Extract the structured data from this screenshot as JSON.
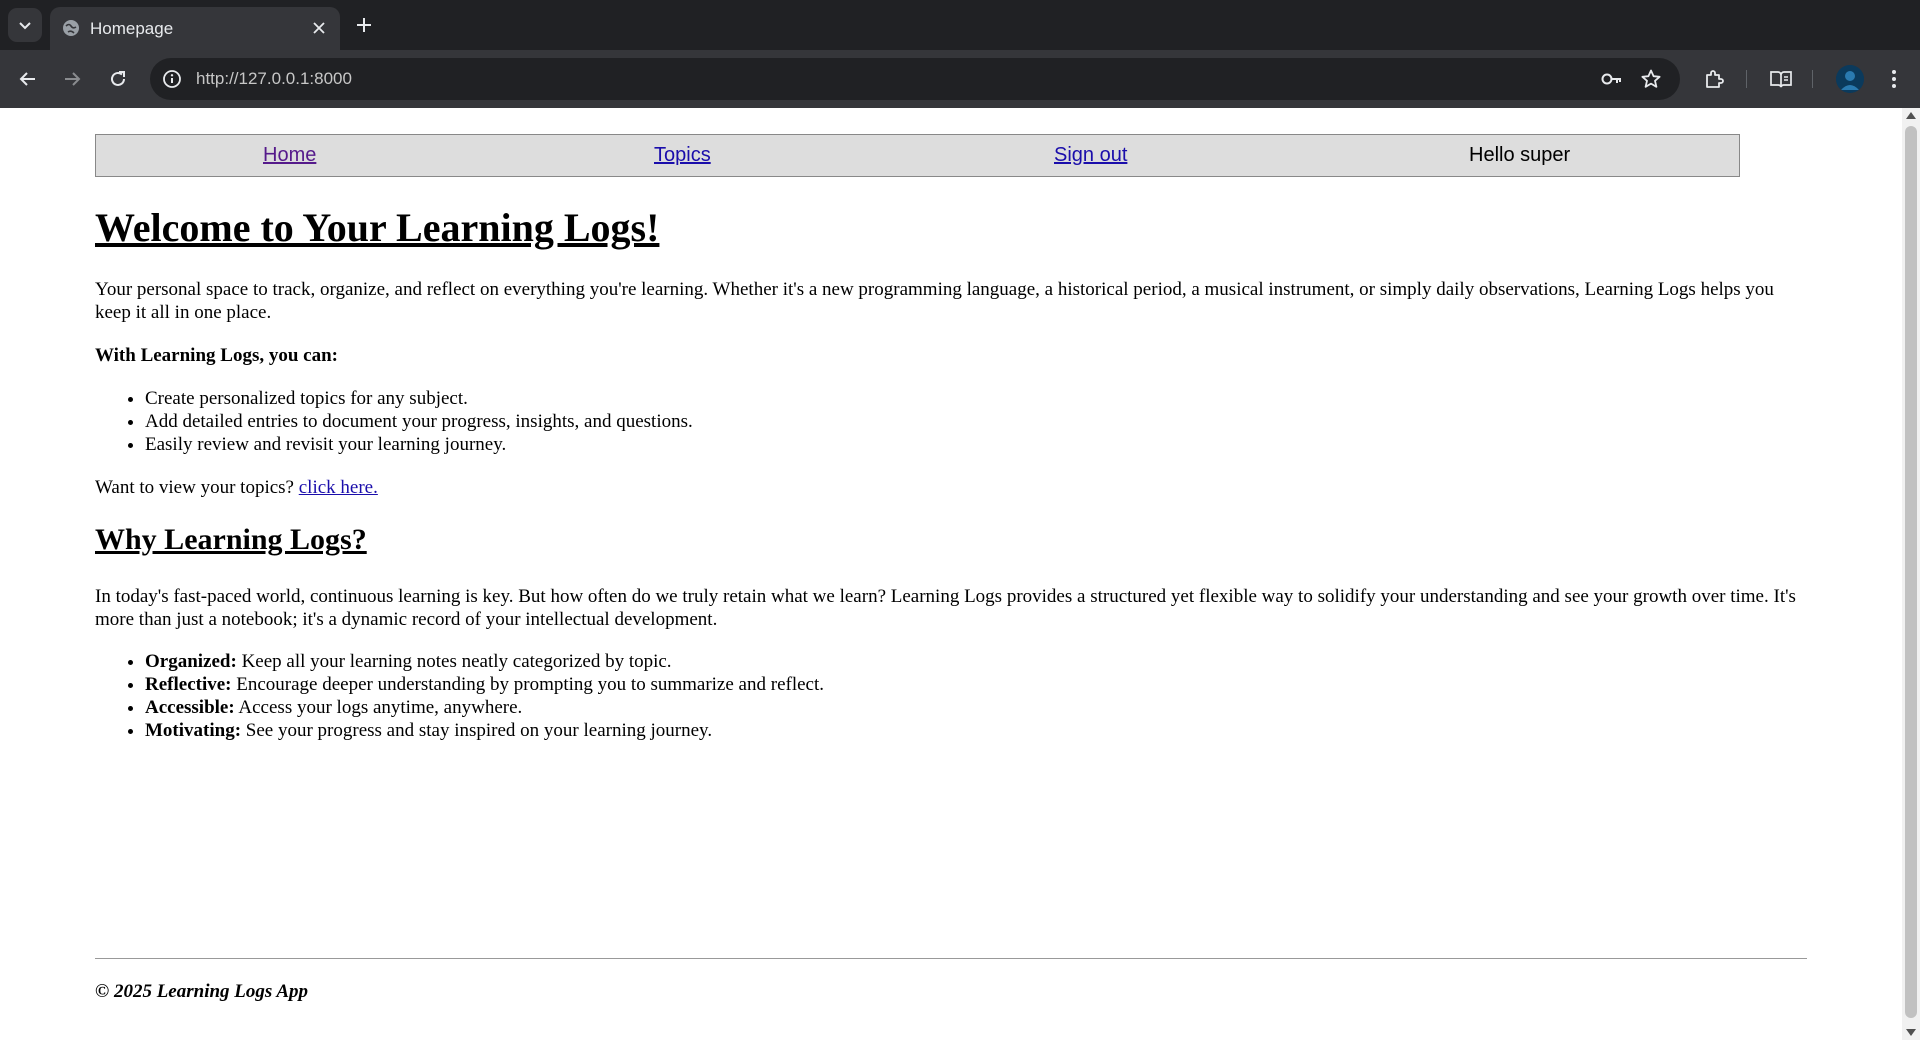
{
  "browser": {
    "tab_title": "Homepage",
    "url": "http://127.0.0.1:8000"
  },
  "nav": {
    "home": "Home",
    "topics": "Topics",
    "sign_out": "Sign out",
    "greeting": "Hello super"
  },
  "content": {
    "heading": "Welcome to Your Learning Logs!",
    "intro": "Your personal space to track, organize, and reflect on everything you're learning. Whether it's a new programming language, a historical period, a musical instrument, or simply daily observations, Learning Logs helps you keep it all in one place.",
    "can_heading": "With Learning Logs, you can:",
    "features": [
      "Create personalized topics for any subject.",
      "Add detailed entries to document your progress, insights, and questions.",
      "Easily review and revisit your learning journey."
    ],
    "view_prompt": "Want to view your topics?",
    "view_link": "click here.",
    "why_heading": "Why Learning Logs?",
    "why_text": "In today's fast-paced world, continuous learning is key. But how often do we truly retain what we learn? Learning Logs provides a structured yet flexible way to solidify your understanding and see your growth over time. It's more than just a notebook; it's a dynamic record of your intellectual development.",
    "benefits": [
      {
        "label": "Organized:",
        "text": "Keep all your learning notes neatly categorized by topic."
      },
      {
        "label": "Reflective:",
        "text": "Encourage deeper understanding by prompting you to summarize and reflect."
      },
      {
        "label": "Accessible:",
        "text": "Access your logs anytime, anywhere."
      },
      {
        "label": "Motivating:",
        "text": "See your progress and stay inspired on your learning journey."
      }
    ]
  },
  "footer": {
    "text": "© 2025 Learning Logs App"
  }
}
